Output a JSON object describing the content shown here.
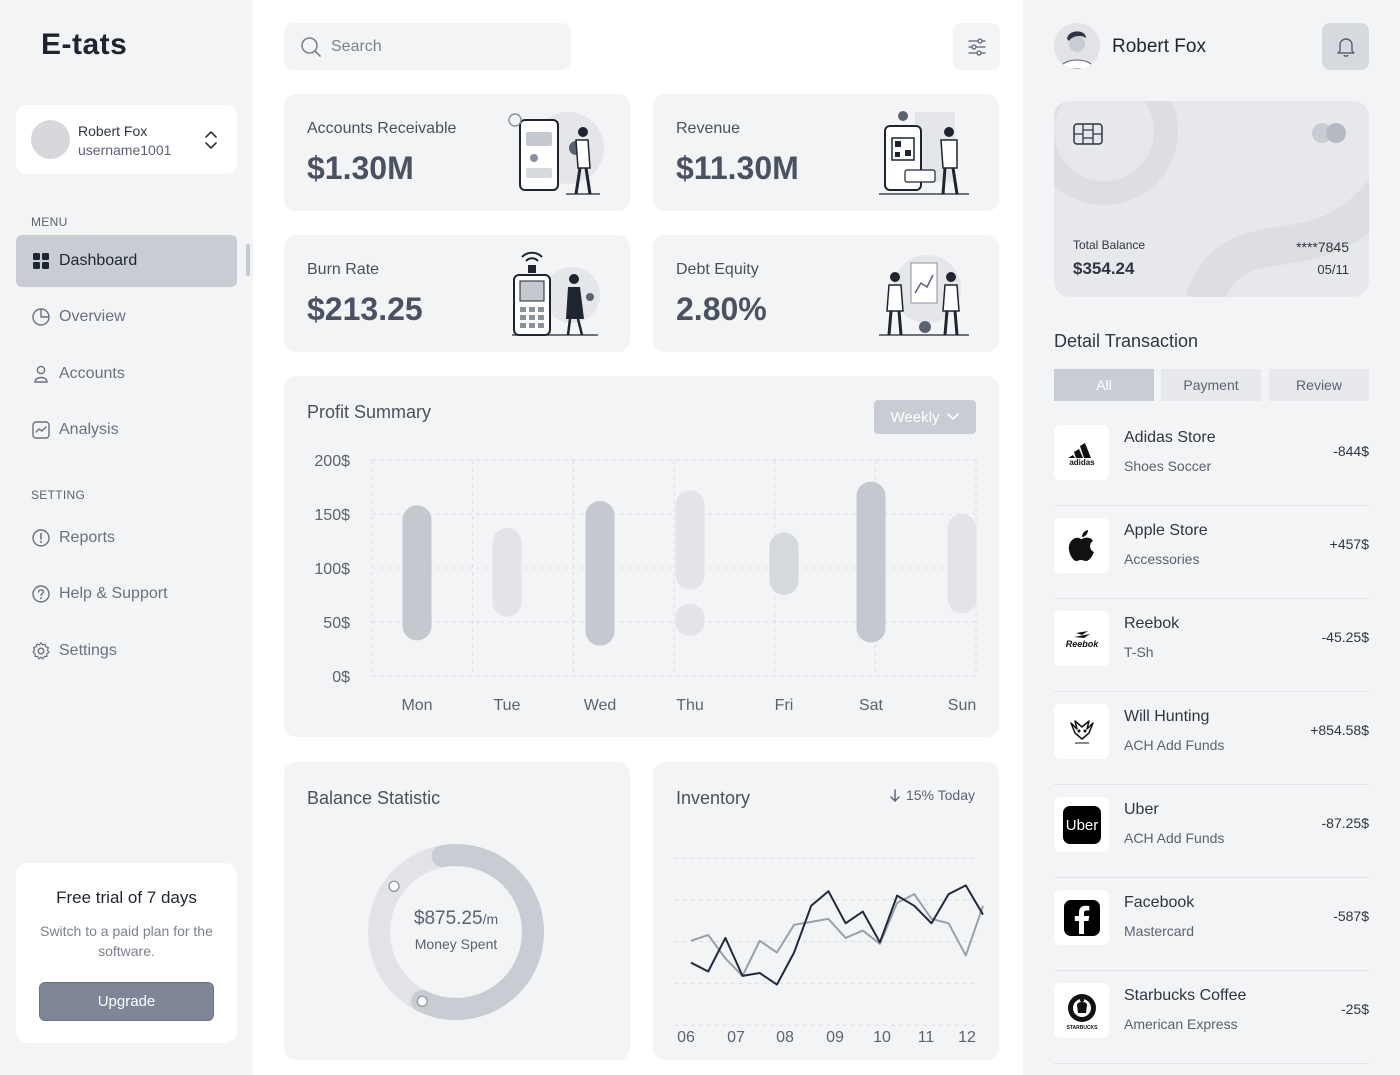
{
  "app": {
    "logo": "E-tats"
  },
  "sidebar": {
    "user": {
      "name": "Robert Fox",
      "username": "username1001"
    },
    "menu_label": "MENU",
    "menu": [
      {
        "label": "Dashboard",
        "icon": "dashboard-grid-icon",
        "active": true
      },
      {
        "label": "Overview",
        "icon": "pie-chart-icon"
      },
      {
        "label": "Accounts",
        "icon": "user-icon"
      },
      {
        "label": "Analysis",
        "icon": "analytics-icon"
      }
    ],
    "setting_label": "SETTING",
    "settings": [
      {
        "label": "Reports",
        "icon": "info-circle-icon"
      },
      {
        "label": "Help & Support",
        "icon": "help-icon"
      },
      {
        "label": "Settings",
        "icon": "gear-icon"
      }
    ],
    "trial": {
      "title": "Free trial of 7 days",
      "text": "Switch to a paid plan for the software.",
      "button": "Upgrade"
    }
  },
  "header": {
    "search_placeholder": "Search"
  },
  "stats": [
    {
      "label": "Accounts Receivable",
      "value": "$1.30M"
    },
    {
      "label": "Revenue",
      "value": "$11.30M"
    },
    {
      "label": "Burn Rate",
      "value": "$213.25"
    },
    {
      "label": "Debt Equity",
      "value": "2.80%"
    }
  ],
  "profit": {
    "title": "Profit Summary",
    "period": "Weekly"
  },
  "chart_data": [
    {
      "type": "bar",
      "title": "Profit Summary",
      "categories": [
        "Mon",
        "Tue",
        "Wed",
        "Thu",
        "Fri",
        "Sat",
        "Sun"
      ],
      "y_ticks": [
        "0$",
        "50$",
        "100$",
        "150$",
        "200$"
      ],
      "ylim": [
        0,
        200
      ],
      "ranges": [
        {
          "low": 33,
          "high": 158
        },
        {
          "low": 55,
          "high": 137
        },
        {
          "low": 28,
          "high": 162
        },
        {
          "low": 37,
          "high": 67,
          "low2": 80,
          "high2": 172
        },
        {
          "low": 75,
          "high": 133
        },
        {
          "low": 31,
          "high": 180
        },
        {
          "low": 58,
          "high": 150
        }
      ],
      "colors": [
        "#c4c8cf",
        "#e2e4e7",
        "#c4c8cf",
        "#e2e4e7",
        "#d6d9de",
        "#c4c8cf",
        "#e2e4e7"
      ]
    },
    {
      "type": "pie",
      "title": "Balance Statistic",
      "values": [
        60,
        40
      ],
      "colors": [
        "#c8ccd3",
        "#e1e3e6"
      ]
    },
    {
      "type": "line",
      "title": "Inventory",
      "categories": [
        "06",
        "07",
        "08",
        "09",
        "10",
        "11",
        "12"
      ],
      "series": [
        {
          "values": [
            51,
            45,
            68,
            42,
            44,
            36,
            58,
            90,
            100,
            78,
            86,
            65,
            97,
            90,
            78,
            98,
            104,
            84
          ],
          "color": "#1f2a3c"
        },
        {
          "values": [
            66,
            70,
            54,
            42,
            66,
            58,
            77,
            79,
            81,
            68,
            73,
            64,
            92,
            98,
            81,
            78,
            56,
            90
          ],
          "color": "#9aa0ab"
        }
      ]
    }
  ],
  "balance": {
    "title": "Balance Statistic",
    "value": "$875.25",
    "unit": "/m",
    "label": "Money Spent"
  },
  "inventory": {
    "title": "Inventory",
    "trend": "15% Today"
  },
  "right": {
    "user_name": "Robert Fox",
    "card": {
      "total_label": "Total Balance",
      "total": "$354.24",
      "number": "****7845",
      "expiry": "05/11"
    },
    "detail_title": "Detail Transaction",
    "tabs": [
      "All",
      "Payment",
      "Review"
    ],
    "transactions": [
      {
        "name": "Adidas Store",
        "sub": "Shoes Soccer",
        "amount": "-844$",
        "logo": "adidas-logo"
      },
      {
        "name": "Apple Store",
        "sub": "Accessories",
        "amount": "+457$",
        "logo": "apple-logo"
      },
      {
        "name": "Reebok",
        "sub": "T-Sh",
        "amount": "-45.25$",
        "logo": "reebok-logo"
      },
      {
        "name": "Will Hunting",
        "sub": "ACH Add Funds",
        "amount": "+854.58$",
        "logo": "will-hunting-logo"
      },
      {
        "name": "Uber",
        "sub": "ACH Add Funds",
        "amount": "-87.25$",
        "logo": "uber-logo"
      },
      {
        "name": "Facebook",
        "sub": "Mastercard",
        "amount": "-587$",
        "logo": "facebook-logo"
      },
      {
        "name": "Starbucks Coffee",
        "sub": "American Express",
        "amount": "-25$",
        "logo": "starbucks-logo"
      }
    ]
  },
  "colors": {
    "accent": "#7f8797",
    "active_nav": "#c8ccd3",
    "panel": "#f3f4f5",
    "dark_line": "#1f2a3c"
  }
}
